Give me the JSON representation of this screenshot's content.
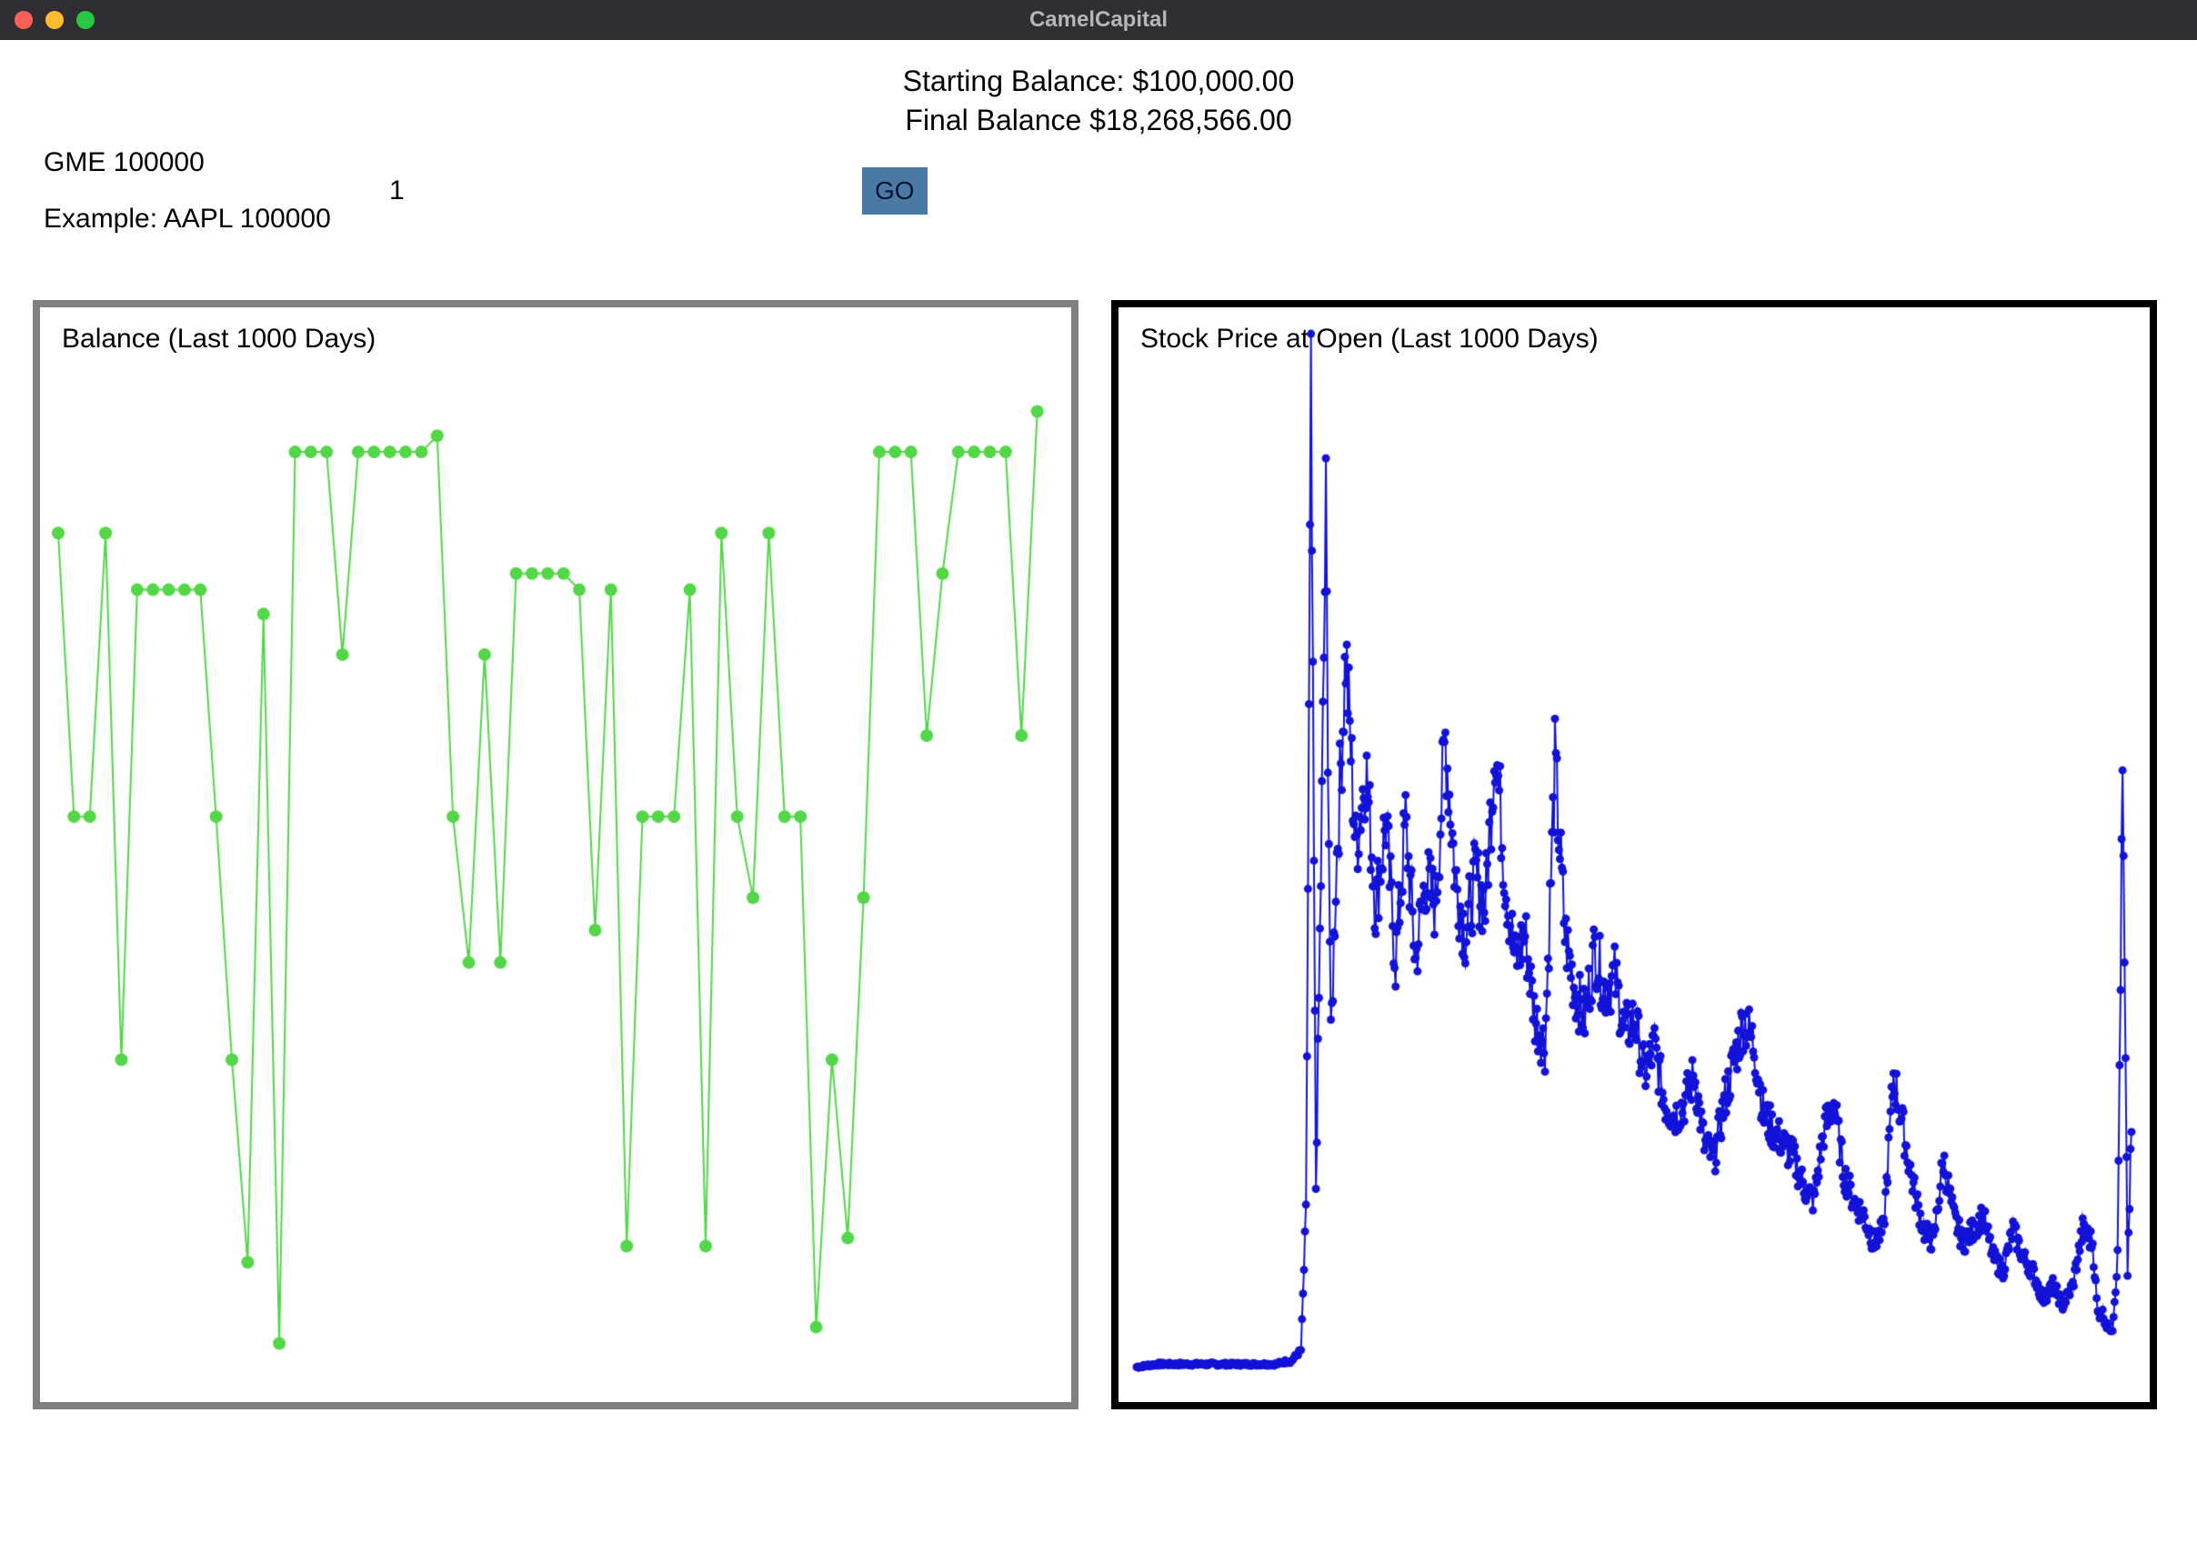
{
  "window": {
    "title": "CamelCapital"
  },
  "summary": {
    "starting_label": "Starting Balance: $100,000.00",
    "final_label": "Final Balance $18,268,566.00"
  },
  "inputs": {
    "ticker_line": "GME 100000",
    "example_line": "Example: AAPL 100000",
    "number_value": "1",
    "go_label": "GO"
  },
  "colors": {
    "balance_line": "#53d648",
    "stock_line": "#1212d8",
    "titlebar_bg": "#2e2e33",
    "go_btn_bg": "#4a79a5"
  },
  "chart_data": [
    {
      "id": "balance",
      "type": "line",
      "title": "Balance (Last 1000 Days)",
      "xlabel": "",
      "ylabel": "",
      "xlim": [
        0,
        63
      ],
      "ylim": [
        -20,
        105
      ],
      "marker": true,
      "color": "#53d648",
      "values": [
        85,
        50,
        50,
        85,
        20,
        78,
        78,
        78,
        78,
        78,
        50,
        20,
        -5,
        75,
        -15,
        95,
        95,
        95,
        70,
        95,
        95,
        95,
        95,
        95,
        97,
        50,
        32,
        70,
        32,
        80,
        80,
        80,
        80,
        78,
        36,
        78,
        -3,
        50,
        50,
        50,
        78,
        -3,
        85,
        50,
        40,
        85,
        50,
        50,
        -13,
        20,
        -2,
        40,
        95,
        95,
        95,
        60,
        80,
        95,
        95,
        95,
        95,
        60,
        100
      ]
    },
    {
      "id": "stock",
      "type": "line",
      "title": "Stock Price at Open (Last 1000 Days)",
      "xlabel": "",
      "ylabel": "",
      "xlim": [
        0,
        999
      ],
      "ylim": [
        0,
        360
      ],
      "marker": true,
      "color": "#1212d8",
      "series_note": "Dense price series over approximately 1000 trading days. Visual trace only; values below are estimates read from the un-labeled chart.",
      "values_sample_x": [
        0,
        20,
        40,
        60,
        80,
        100,
        110,
        120,
        130,
        140,
        150,
        155,
        160,
        165,
        170,
        175,
        180,
        185,
        190,
        195,
        200,
        210,
        220,
        230,
        240,
        250,
        260,
        270,
        280,
        290,
        300,
        310,
        320,
        330,
        340,
        350,
        360,
        370,
        380,
        390,
        400,
        410,
        420,
        430,
        440,
        450,
        460,
        470,
        480,
        490,
        500,
        510,
        520,
        530,
        540,
        550,
        560,
        570,
        580,
        590,
        600,
        610,
        620,
        630,
        640,
        650,
        660,
        670,
        680,
        690,
        700,
        710,
        720,
        730,
        740,
        750,
        760,
        770,
        780,
        790,
        800,
        810,
        820,
        830,
        840,
        850,
        860,
        870,
        880,
        890,
        900,
        910,
        920,
        930,
        940,
        950,
        960,
        965,
        970,
        975,
        980,
        985,
        990,
        995,
        999
      ],
      "values_sample_y": [
        6,
        7,
        7,
        7,
        7,
        7,
        7,
        7,
        7,
        7,
        8,
        8,
        10,
        12,
        60,
        350,
        70,
        180,
        310,
        120,
        180,
        260,
        190,
        220,
        170,
        200,
        150,
        200,
        150,
        180,
        170,
        230,
        180,
        160,
        180,
        170,
        230,
        180,
        150,
        160,
        130,
        120,
        220,
        160,
        140,
        130,
        155,
        140,
        145,
        125,
        130,
        110,
        120,
        100,
        95,
        100,
        110,
        85,
        80,
        100,
        115,
        130,
        120,
        95,
        90,
        85,
        80,
        70,
        65,
        90,
        100,
        75,
        65,
        60,
        50,
        55,
        110,
        90,
        70,
        55,
        50,
        80,
        60,
        50,
        55,
        60,
        45,
        40,
        55,
        45,
        40,
        30,
        35,
        28,
        35,
        55,
        50,
        25,
        25,
        20,
        20,
        45,
        215,
        40,
        90
      ]
    }
  ]
}
